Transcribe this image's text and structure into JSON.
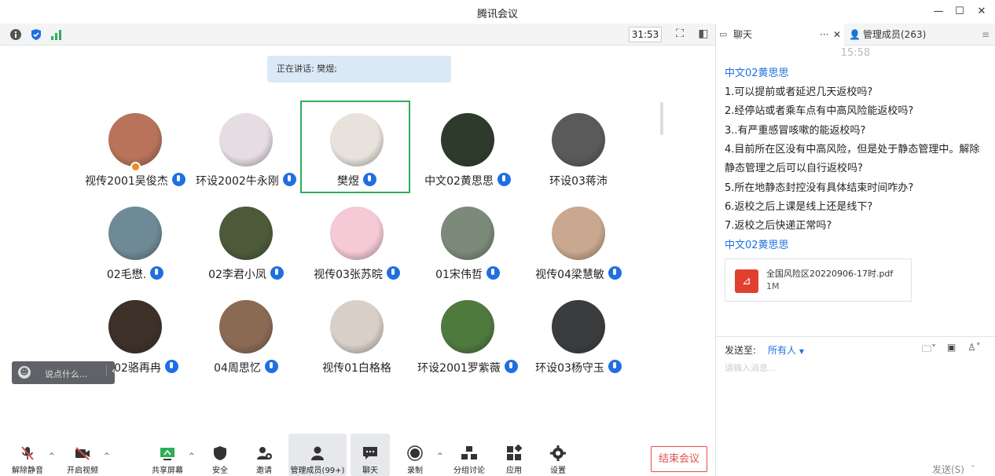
{
  "window": {
    "title": "腾讯会议"
  },
  "infobar": {
    "timer": "31:53"
  },
  "speaking": "正在讲话: 樊煜;",
  "participants": [
    {
      "name": "视传2001吴俊杰",
      "mic": true,
      "host": true,
      "color": "#b8735a"
    },
    {
      "name": "环设2002牛永刚",
      "mic": true,
      "color": "#e6dde3"
    },
    {
      "name": "樊煜",
      "mic": true,
      "active": true,
      "color": "#e7e3dc"
    },
    {
      "name": "中文02黄思思",
      "mic": true,
      "color": "#2e3b2c"
    },
    {
      "name": "环设03蒋沛",
      "mic": false,
      "color": "#5a5a5a"
    },
    {
      "name": "02毛懋.",
      "mic": true,
      "color": "#6e8a96"
    },
    {
      "name": "02李君小凤",
      "mic": true,
      "color": "#4c5a3a"
    },
    {
      "name": "视传03张苏晥",
      "mic": true,
      "color": "#f5c9d6"
    },
    {
      "name": "01宋伟哲",
      "mic": true,
      "color": "#7c8a7a"
    },
    {
      "name": "视传04梁慧敏",
      "mic": true,
      "color": "#caa88f"
    },
    {
      "name": "视传02骆再冉",
      "mic": true,
      "color": "#3c3028"
    },
    {
      "name": "04周思忆",
      "mic": true,
      "color": "#8b6a54"
    },
    {
      "name": "视传01白格格",
      "mic": false,
      "color": "#d9cfc9"
    },
    {
      "name": "环设2001罗紫薇",
      "mic": true,
      "color": "#4f7a3e"
    },
    {
      "name": "环设03杨守玉",
      "mic": true,
      "color": "#3a3c3e"
    }
  ],
  "chat_input_pill": {
    "placeholder": "说点什么..."
  },
  "toolbar": {
    "mute": "解除静音",
    "video": "开启视频",
    "share": "共享屏幕",
    "security": "安全",
    "invite": "邀请",
    "members": "管理成员(99+)",
    "chat": "聊天",
    "record": "录制",
    "breakout": "分组讨论",
    "apps": "应用",
    "settings": "设置",
    "end": "结束会议"
  },
  "panel": {
    "tab_chat": "聊天",
    "tab_members": "管理成员(263)",
    "time": "15:58",
    "sender1": "中文02黄思思",
    "lines": [
      "1.可以提前或者延迟几天返校吗?",
      "2.经停站或者乘车点有中高风险能返校吗?",
      "3..有严重感冒咳嗽的能返校吗?",
      "4.目前所在区没有中高风险，但是处于静态管理中。解除",
      "静态管理之后可以自行返校吗?",
      "5.所在地静态封控没有具体结束时间咋办?",
      "6.返校之后上课是线上还是线下?",
      "7.返校之后快递正常吗?"
    ],
    "sender2": "中文02黄思思",
    "file_name": "全国风险区20220906-17时.pdf",
    "file_size": "1M",
    "send_to_label": "发送至:",
    "send_to_value": "所有人",
    "message_placeholder": "请输入消息...",
    "send_button": "发送(S)"
  }
}
